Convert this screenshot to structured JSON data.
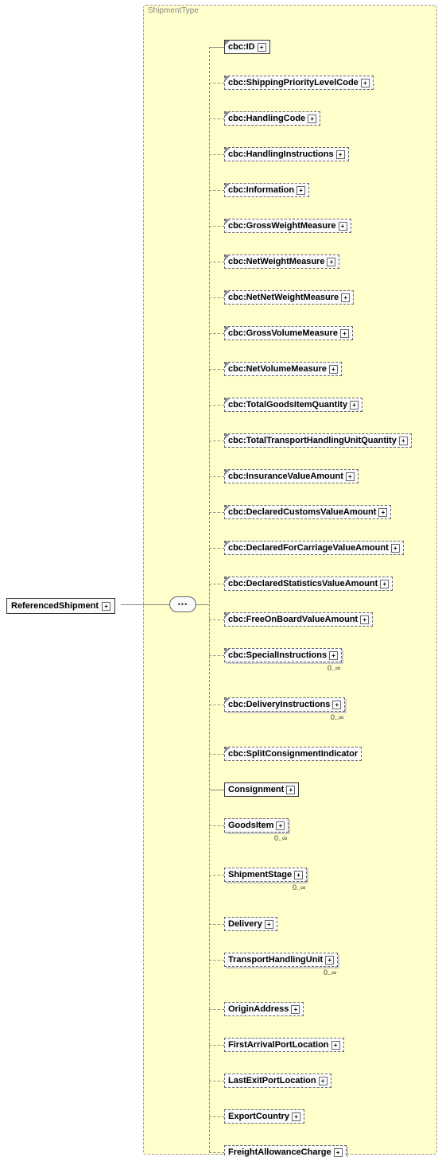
{
  "root": {
    "label": "ReferencedShipment"
  },
  "typeLabel": "ShipmentType",
  "expandGlyph": "+",
  "cardinality": "0..∞",
  "children": [
    {
      "label": "cbc:ID",
      "optional": false,
      "corner": true,
      "expand": true,
      "card": false
    },
    {
      "label": "cbc:ShippingPriorityLevelCode",
      "optional": true,
      "corner": true,
      "expand": true,
      "card": false
    },
    {
      "label": "cbc:HandlingCode",
      "optional": true,
      "corner": true,
      "expand": true,
      "card": false
    },
    {
      "label": "cbc:HandlingInstructions",
      "optional": true,
      "corner": true,
      "expand": true,
      "card": false
    },
    {
      "label": "cbc:Information",
      "optional": true,
      "corner": true,
      "expand": true,
      "card": false
    },
    {
      "label": "cbc:GrossWeightMeasure",
      "optional": true,
      "corner": true,
      "expand": true,
      "card": false
    },
    {
      "label": "cbc:NetWeightMeasure",
      "optional": true,
      "corner": true,
      "expand": true,
      "card": false
    },
    {
      "label": "cbc:NetNetWeightMeasure",
      "optional": true,
      "corner": true,
      "expand": true,
      "card": false
    },
    {
      "label": "cbc:GrossVolumeMeasure",
      "optional": true,
      "corner": true,
      "expand": true,
      "card": false
    },
    {
      "label": "cbc:NetVolumeMeasure",
      "optional": true,
      "corner": true,
      "expand": true,
      "card": false
    },
    {
      "label": "cbc:TotalGoodsItemQuantity",
      "optional": true,
      "corner": true,
      "expand": true,
      "card": false
    },
    {
      "label": "cbc:TotalTransportHandlingUnitQuantity",
      "optional": true,
      "corner": true,
      "expand": true,
      "card": false
    },
    {
      "label": "cbc:InsuranceValueAmount",
      "optional": true,
      "corner": true,
      "expand": true,
      "card": false
    },
    {
      "label": "cbc:DeclaredCustomsValueAmount",
      "optional": true,
      "corner": true,
      "expand": true,
      "card": false
    },
    {
      "label": "cbc:DeclaredForCarriageValueAmount",
      "optional": true,
      "corner": true,
      "expand": true,
      "card": false
    },
    {
      "label": "cbc:DeclaredStatisticsValueAmount",
      "optional": true,
      "corner": true,
      "expand": true,
      "card": false
    },
    {
      "label": "cbc:FreeOnBoardValueAmount",
      "optional": true,
      "corner": true,
      "expand": true,
      "card": false
    },
    {
      "label": "cbc:SpecialInstructions",
      "optional": true,
      "corner": true,
      "expand": true,
      "card": true,
      "shadow": true
    },
    {
      "label": "cbc:DeliveryInstructions",
      "optional": true,
      "corner": true,
      "expand": true,
      "card": true,
      "shadow": true
    },
    {
      "label": "cbc:SplitConsignmentIndicator",
      "optional": true,
      "corner": true,
      "expand": false,
      "card": false
    },
    {
      "label": "Consignment",
      "optional": false,
      "corner": false,
      "expand": true,
      "card": false
    },
    {
      "label": "GoodsItem",
      "optional": true,
      "corner": false,
      "expand": true,
      "card": true,
      "shadow": true
    },
    {
      "label": "ShipmentStage",
      "optional": true,
      "corner": false,
      "expand": true,
      "card": true,
      "shadow": true
    },
    {
      "label": "Delivery",
      "optional": true,
      "corner": false,
      "expand": true,
      "card": false
    },
    {
      "label": "TransportHandlingUnit",
      "optional": true,
      "corner": false,
      "expand": true,
      "card": true,
      "shadow": true
    },
    {
      "label": "OriginAddress",
      "optional": true,
      "corner": false,
      "expand": true,
      "card": false
    },
    {
      "label": "FirstArrivalPortLocation",
      "optional": true,
      "corner": false,
      "expand": true,
      "card": false
    },
    {
      "label": "LastExitPortLocation",
      "optional": true,
      "corner": false,
      "expand": true,
      "card": false
    },
    {
      "label": "ExportCountry",
      "optional": true,
      "corner": false,
      "expand": true,
      "card": false
    },
    {
      "label": "FreightAllowanceCharge",
      "optional": true,
      "corner": false,
      "expand": true,
      "card": true,
      "shadow": true
    }
  ]
}
